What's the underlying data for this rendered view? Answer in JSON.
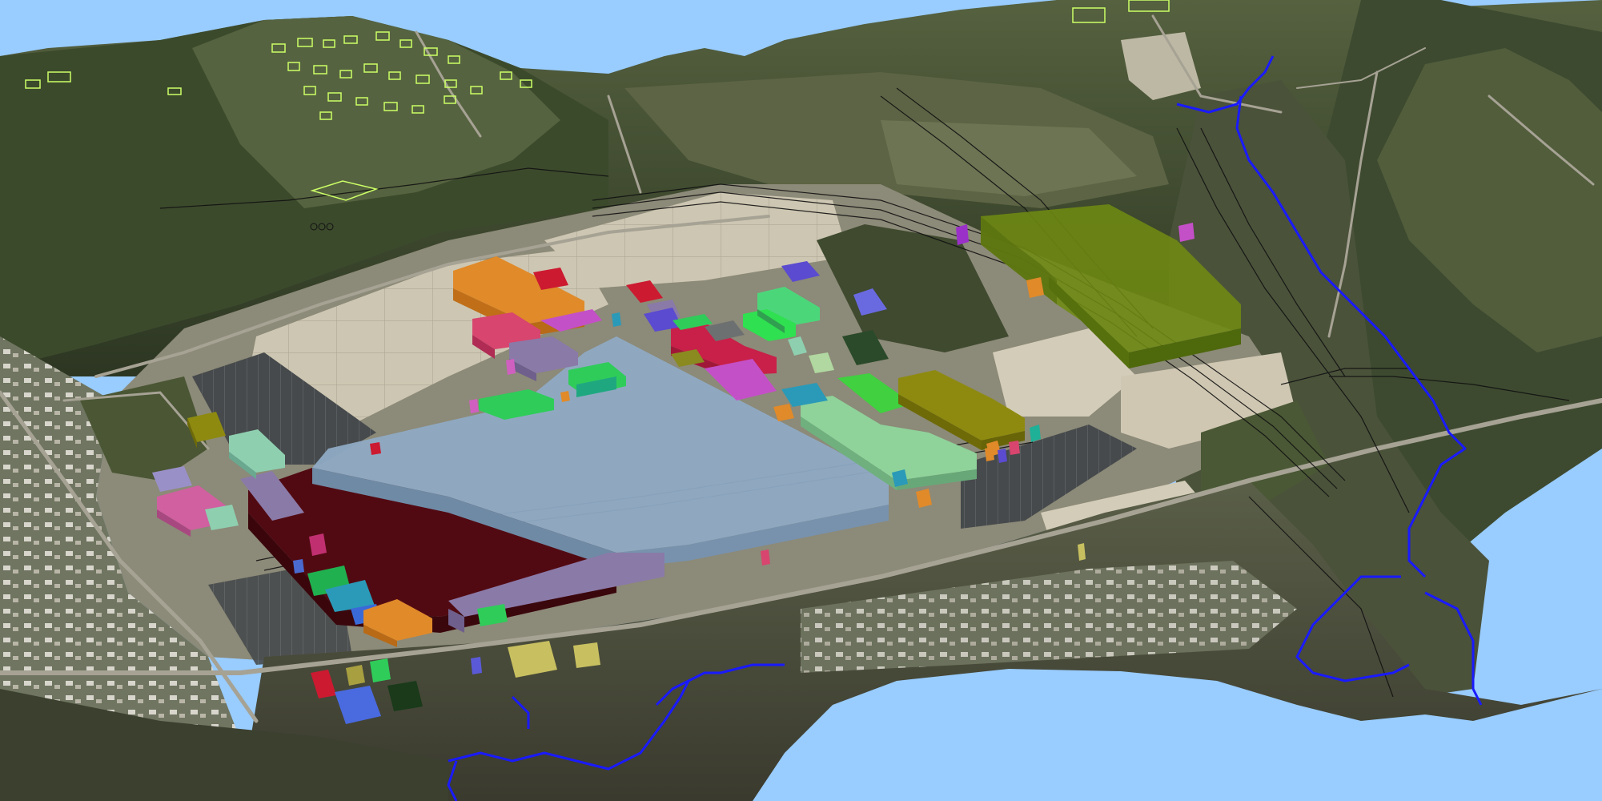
{
  "scene": {
    "sky_color": "#99ccff",
    "terrain_colors": {
      "forest_dark": "#2f3a24",
      "forest_mid": "#4a5a36",
      "forest_light": "#6b7a4c",
      "ridge_brown": "#5e5243",
      "lot_concrete": "#c8c0aa",
      "lot_light": "#d8d2c0",
      "asphalt": "#3e4244",
      "field_green": "#4d5e3a",
      "residential": "#7a7f6e"
    },
    "rail_color": "#111111",
    "stream_color": "#1a1aff",
    "parcel_outline_color": "#ccff66",
    "building_colors": {
      "main_plant": "#8faac4",
      "main_plant_annex": "#520a12",
      "olive_warehouse": "#6f8a12",
      "orange_block": "#e08a2a",
      "mint_block": "#8fd29a",
      "yellow_olive": "#8e8a10",
      "lavender": "#8a7aa8",
      "pink": "#d8456e",
      "green_bright": "#2fcc5a",
      "blue": "#5a4bd0",
      "magenta": "#c450c8",
      "teal": "#2a9ab8",
      "red": "#cc1a30",
      "olive_dark": "#8a8a20",
      "sage": "#8ecfb0",
      "khaki": "#c8c060"
    }
  }
}
